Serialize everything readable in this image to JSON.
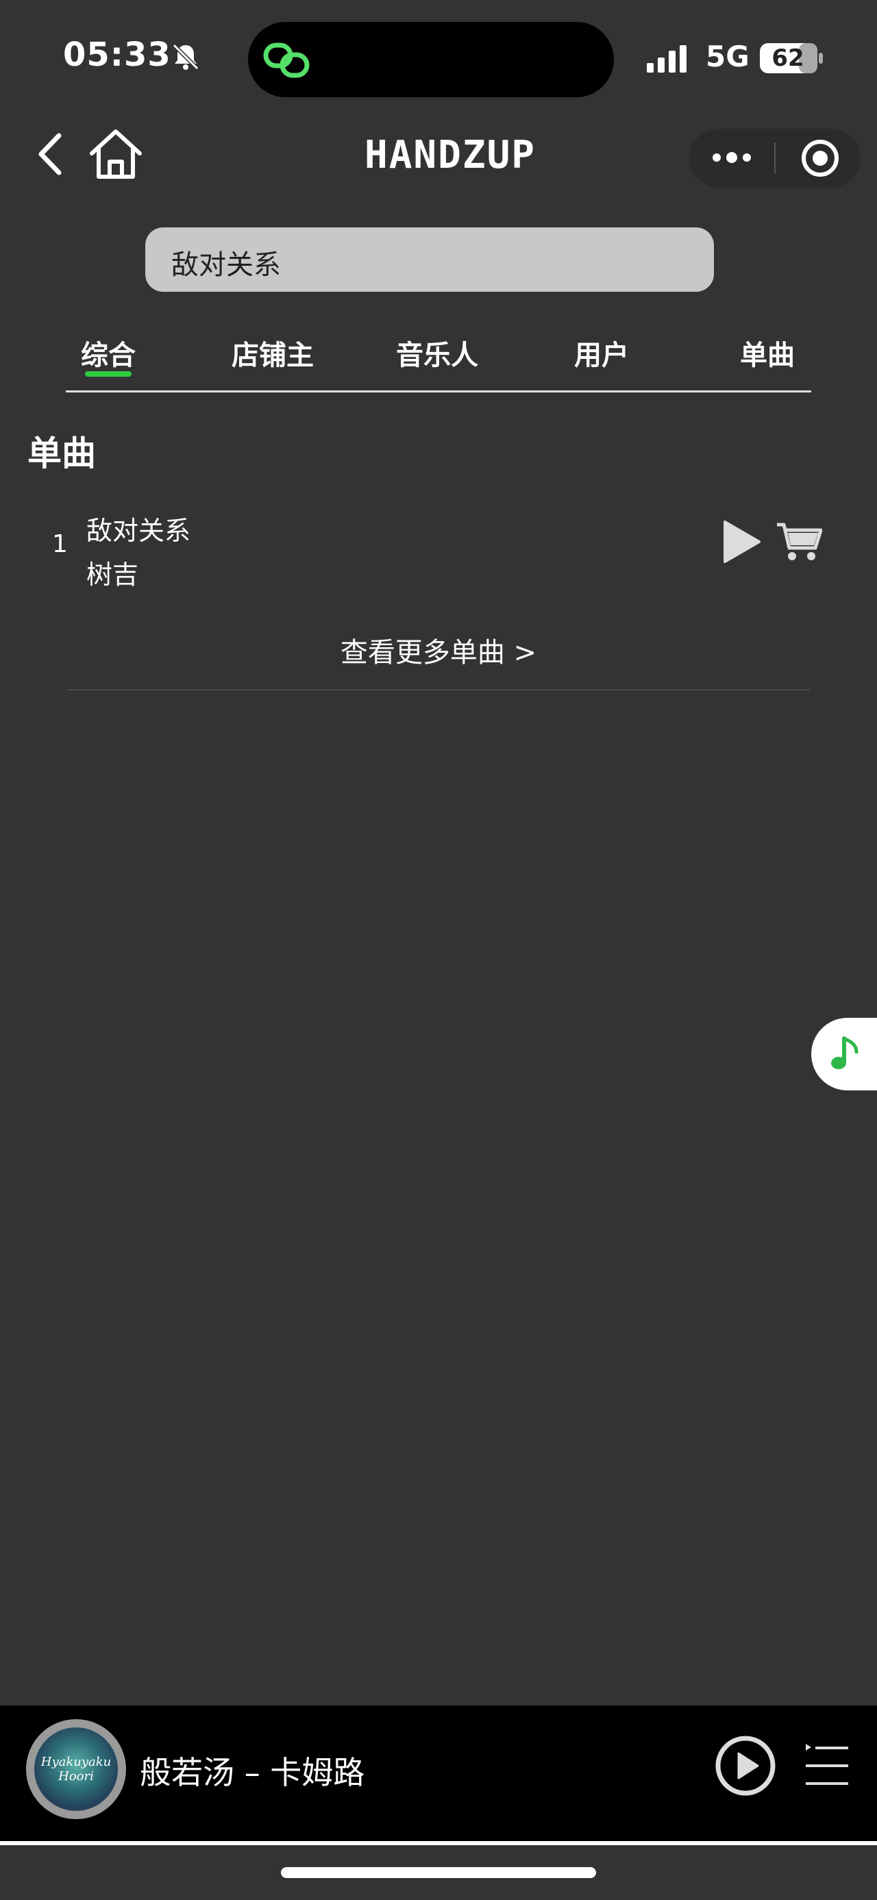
{
  "status_bar": {
    "time": "05:33",
    "network": "5G",
    "battery": "62"
  },
  "header": {
    "logo": "HANDZUP"
  },
  "search": {
    "query": "敌对关系"
  },
  "tabs": [
    {
      "label": "综合",
      "active": true
    },
    {
      "label": "店铺主"
    },
    {
      "label": "音乐人"
    },
    {
      "label": "用户"
    },
    {
      "label": "单曲"
    }
  ],
  "section": {
    "title": "单曲",
    "songs": [
      {
        "index": "1",
        "title": "敌对关系",
        "artist": "树吉"
      }
    ],
    "more_link": "查看更多单曲 >"
  },
  "player": {
    "now_playing": "般若汤 – 卡姆路",
    "album_art_text": "Hyakuyaku Hoori"
  },
  "colors": {
    "background": "#333333",
    "accent": "#2ecc40",
    "player_bg": "#000000"
  },
  "icons": [
    "bell-slash-icon",
    "link-icon",
    "signal-icon",
    "battery-icon",
    "back-icon",
    "home-icon",
    "more-icon",
    "target-icon",
    "play-icon",
    "cart-icon",
    "music-note-icon",
    "playlist-icon"
  ]
}
